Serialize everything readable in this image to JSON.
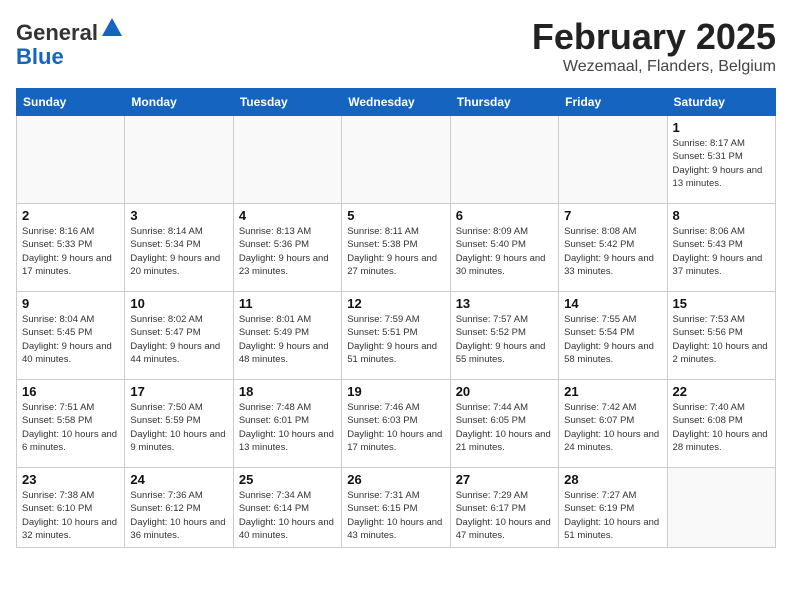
{
  "header": {
    "logo_general": "General",
    "logo_blue": "Blue",
    "month_title": "February 2025",
    "subtitle": "Wezemaal, Flanders, Belgium"
  },
  "weekdays": [
    "Sunday",
    "Monday",
    "Tuesday",
    "Wednesday",
    "Thursday",
    "Friday",
    "Saturday"
  ],
  "weeks": [
    [
      {
        "day": "",
        "info": ""
      },
      {
        "day": "",
        "info": ""
      },
      {
        "day": "",
        "info": ""
      },
      {
        "day": "",
        "info": ""
      },
      {
        "day": "",
        "info": ""
      },
      {
        "day": "",
        "info": ""
      },
      {
        "day": "1",
        "info": "Sunrise: 8:17 AM\nSunset: 5:31 PM\nDaylight: 9 hours and 13 minutes."
      }
    ],
    [
      {
        "day": "2",
        "info": "Sunrise: 8:16 AM\nSunset: 5:33 PM\nDaylight: 9 hours and 17 minutes."
      },
      {
        "day": "3",
        "info": "Sunrise: 8:14 AM\nSunset: 5:34 PM\nDaylight: 9 hours and 20 minutes."
      },
      {
        "day": "4",
        "info": "Sunrise: 8:13 AM\nSunset: 5:36 PM\nDaylight: 9 hours and 23 minutes."
      },
      {
        "day": "5",
        "info": "Sunrise: 8:11 AM\nSunset: 5:38 PM\nDaylight: 9 hours and 27 minutes."
      },
      {
        "day": "6",
        "info": "Sunrise: 8:09 AM\nSunset: 5:40 PM\nDaylight: 9 hours and 30 minutes."
      },
      {
        "day": "7",
        "info": "Sunrise: 8:08 AM\nSunset: 5:42 PM\nDaylight: 9 hours and 33 minutes."
      },
      {
        "day": "8",
        "info": "Sunrise: 8:06 AM\nSunset: 5:43 PM\nDaylight: 9 hours and 37 minutes."
      }
    ],
    [
      {
        "day": "9",
        "info": "Sunrise: 8:04 AM\nSunset: 5:45 PM\nDaylight: 9 hours and 40 minutes."
      },
      {
        "day": "10",
        "info": "Sunrise: 8:02 AM\nSunset: 5:47 PM\nDaylight: 9 hours and 44 minutes."
      },
      {
        "day": "11",
        "info": "Sunrise: 8:01 AM\nSunset: 5:49 PM\nDaylight: 9 hours and 48 minutes."
      },
      {
        "day": "12",
        "info": "Sunrise: 7:59 AM\nSunset: 5:51 PM\nDaylight: 9 hours and 51 minutes."
      },
      {
        "day": "13",
        "info": "Sunrise: 7:57 AM\nSunset: 5:52 PM\nDaylight: 9 hours and 55 minutes."
      },
      {
        "day": "14",
        "info": "Sunrise: 7:55 AM\nSunset: 5:54 PM\nDaylight: 9 hours and 58 minutes."
      },
      {
        "day": "15",
        "info": "Sunrise: 7:53 AM\nSunset: 5:56 PM\nDaylight: 10 hours and 2 minutes."
      }
    ],
    [
      {
        "day": "16",
        "info": "Sunrise: 7:51 AM\nSunset: 5:58 PM\nDaylight: 10 hours and 6 minutes."
      },
      {
        "day": "17",
        "info": "Sunrise: 7:50 AM\nSunset: 5:59 PM\nDaylight: 10 hours and 9 minutes."
      },
      {
        "day": "18",
        "info": "Sunrise: 7:48 AM\nSunset: 6:01 PM\nDaylight: 10 hours and 13 minutes."
      },
      {
        "day": "19",
        "info": "Sunrise: 7:46 AM\nSunset: 6:03 PM\nDaylight: 10 hours and 17 minutes."
      },
      {
        "day": "20",
        "info": "Sunrise: 7:44 AM\nSunset: 6:05 PM\nDaylight: 10 hours and 21 minutes."
      },
      {
        "day": "21",
        "info": "Sunrise: 7:42 AM\nSunset: 6:07 PM\nDaylight: 10 hours and 24 minutes."
      },
      {
        "day": "22",
        "info": "Sunrise: 7:40 AM\nSunset: 6:08 PM\nDaylight: 10 hours and 28 minutes."
      }
    ],
    [
      {
        "day": "23",
        "info": "Sunrise: 7:38 AM\nSunset: 6:10 PM\nDaylight: 10 hours and 32 minutes."
      },
      {
        "day": "24",
        "info": "Sunrise: 7:36 AM\nSunset: 6:12 PM\nDaylight: 10 hours and 36 minutes."
      },
      {
        "day": "25",
        "info": "Sunrise: 7:34 AM\nSunset: 6:14 PM\nDaylight: 10 hours and 40 minutes."
      },
      {
        "day": "26",
        "info": "Sunrise: 7:31 AM\nSunset: 6:15 PM\nDaylight: 10 hours and 43 minutes."
      },
      {
        "day": "27",
        "info": "Sunrise: 7:29 AM\nSunset: 6:17 PM\nDaylight: 10 hours and 47 minutes."
      },
      {
        "day": "28",
        "info": "Sunrise: 7:27 AM\nSunset: 6:19 PM\nDaylight: 10 hours and 51 minutes."
      },
      {
        "day": "",
        "info": ""
      }
    ]
  ]
}
